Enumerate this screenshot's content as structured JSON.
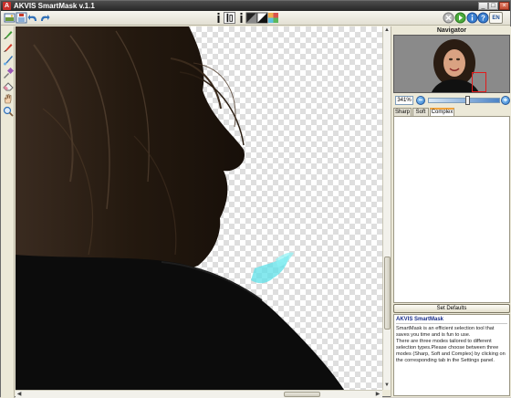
{
  "window": {
    "title": "AKVIS SmartMask v.1.1",
    "logo": "akvis-logo",
    "controls": [
      "minimize-icon",
      "maximize-icon",
      "close-icon"
    ]
  },
  "toolbar": {
    "left_buttons": [
      "open-image-icon",
      "save-image-icon",
      "undo-icon",
      "redo-icon"
    ],
    "center_buttons": [
      "magic-selection-icon",
      "selection-brush-icon",
      "selection-info-icon",
      "black-background-icon",
      "color-background-icon",
      "transparency-icon"
    ],
    "right_buttons": [
      "cancel-icon",
      "run-icon",
      "info-icon",
      "help-icon"
    ],
    "language": "EN"
  },
  "tools": [
    "keep-pencil-icon",
    "drop-pencil-icon",
    "brush-icon",
    "color-picker-icon",
    "eraser-icon",
    "hand-icon",
    "zoom-icon"
  ],
  "navigator": {
    "title": "Navigator",
    "zoom": "341%",
    "zoom_level": 0.55
  },
  "tabs": [
    {
      "label": "Sharp",
      "active": false
    },
    {
      "label": "Soft",
      "active": false
    },
    {
      "label": "Complex",
      "active": true
    }
  ],
  "buttons": {
    "set_defaults": "Set Defaults"
  },
  "help": {
    "title": "AKVIS SmartMask",
    "text": "SmartMask is an efficient selection tool that saves you time and is fun to use.\nThere are three modes tailored to different selection types.Please choose between three modes (Sharp, Soft and Complex) by clicking on the corresponding tab in the Settings panel."
  },
  "colors": {
    "accent_tab": "#f1a33b",
    "marker_stroke": "#e21b1b",
    "title_bar": "#262626"
  }
}
